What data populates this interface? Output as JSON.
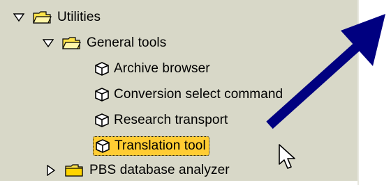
{
  "tree": {
    "root": {
      "label": "Utilities",
      "expanded": true
    },
    "group": {
      "label": "General tools",
      "expanded": true
    },
    "items": [
      {
        "label": "Archive browser"
      },
      {
        "label": "Conversion select command"
      },
      {
        "label": "Research transport"
      },
      {
        "label": "Translation tool",
        "selected": true
      }
    ],
    "sibling": {
      "label": "PBS database analyzer",
      "expanded": false
    }
  },
  "colors": {
    "panel_bg": "#d8d8c8",
    "selection": "#ffcc33",
    "arrow": "#000080",
    "folder": "#ffd400"
  },
  "icons": {
    "expand_open": "triangle-down-icon",
    "expand_closed": "triangle-right-icon",
    "folder_open": "open-folder-icon",
    "folder_closed": "closed-folder-icon",
    "item": "cube-icon",
    "pointer": "mouse-cursor-icon",
    "annotation": "annotation-arrow"
  }
}
